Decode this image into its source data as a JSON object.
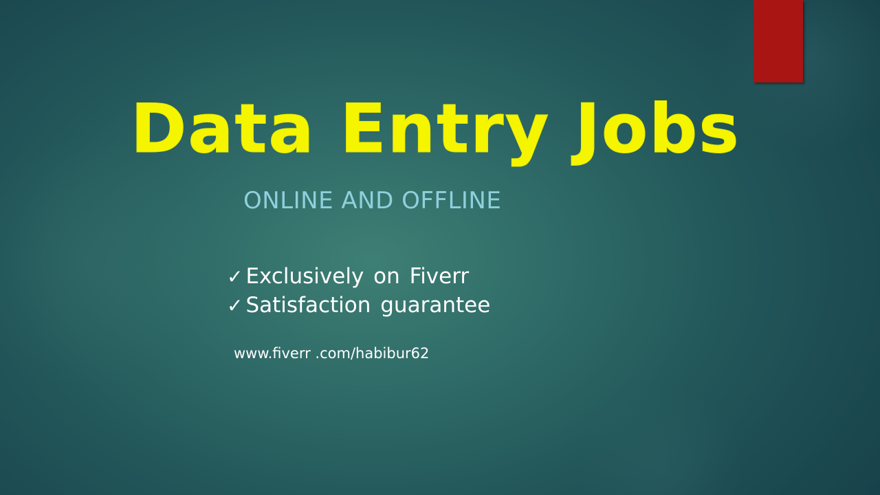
{
  "slide": {
    "title": "Data Entry Jobs",
    "subtitle": "ONLINE AND OFFLINE",
    "bullets": [
      {
        "icon": "check-icon",
        "symbol": "✓",
        "label": "Exclusively on Fiverr"
      },
      {
        "icon": "check-icon",
        "symbol": "✓",
        "label": "Satisfaction  guarantee"
      }
    ],
    "url": "www.fiverr .com/habibur62"
  },
  "colors": {
    "title": "#f5f500",
    "subtitle": "#8fd0dc",
    "body_text": "#ffffff",
    "accent_tab": "#a81512",
    "background_center": "#3e7f74",
    "background_edge": "#17414a"
  }
}
